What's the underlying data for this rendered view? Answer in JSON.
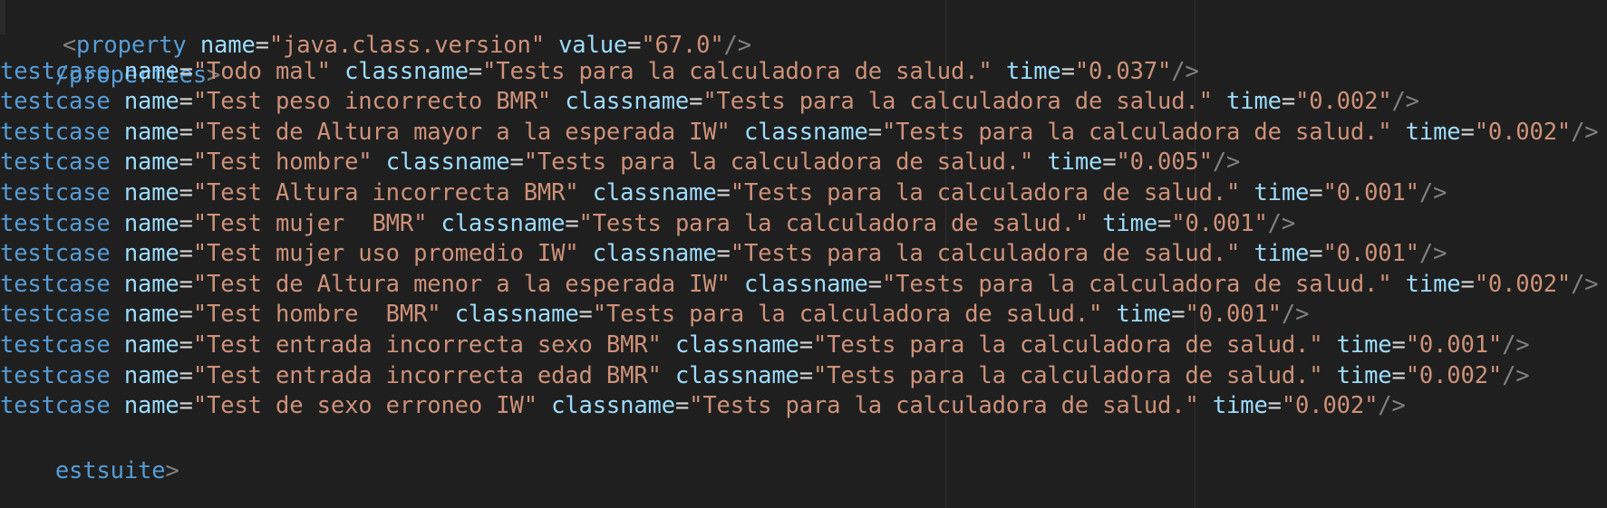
{
  "editor": {
    "property_line": {
      "tag": "property",
      "attrs": [
        {
          "name": "name",
          "value": "\"java.class.version\""
        },
        {
          "name": "value",
          "value": "\"67.0\""
        }
      ],
      "close": "/>"
    },
    "properties_close": {
      "tag": "/properties"
    },
    "testcases": [
      {
        "name": "\"Todo mal\"",
        "classname": "\"Tests para la calculadora de salud.\"",
        "time": "\"0.037\""
      },
      {
        "name": "\"Test peso incorrecto BMR\"",
        "classname": "\"Tests para la calculadora de salud.\"",
        "time": "\"0.002\""
      },
      {
        "name": "\"Test de Altura mayor a la esperada IW\"",
        "classname": "\"Tests para la calculadora de salud.\"",
        "time": "\"0.002\""
      },
      {
        "name": "\"Test hombre\"",
        "classname": "\"Tests para la calculadora de salud.\"",
        "time": "\"0.005\""
      },
      {
        "name": "\"Test Altura incorrecta BMR\"",
        "classname": "\"Tests para la calculadora de salud.\"",
        "time": "\"0.001\""
      },
      {
        "name": "\"Test mujer  BMR\"",
        "classname": "\"Tests para la calculadora de salud.\"",
        "time": "\"0.001\""
      },
      {
        "name": "\"Test mujer uso promedio IW\"",
        "classname": "\"Tests para la calculadora de salud.\"",
        "time": "\"0.001\""
      },
      {
        "name": "\"Test de Altura menor a la esperada IW\"",
        "classname": "\"Tests para la calculadora de salud.\"",
        "time": "\"0.002\""
      },
      {
        "name": "\"Test hombre  BMR\"",
        "classname": "\"Tests para la calculadora de salud.\"",
        "time": "\"0.001\""
      },
      {
        "name": "\"Test entrada incorrecta sexo BMR\"",
        "classname": "\"Tests para la calculadora de salud.\"",
        "time": "\"0.001\""
      },
      {
        "name": "\"Test entrada incorrecta edad BMR\"",
        "classname": "\"Tests para la calculadora de salud.\"",
        "time": "\"0.002\""
      },
      {
        "name": "\"Test de sexo erroneo IW\"",
        "classname": "\"Tests para la calculadora de salud.\"",
        "time": "\"0.002\""
      }
    ],
    "testcase_tag": "testcase",
    "attr_name": "name",
    "attr_classname": "classname",
    "attr_time": "time",
    "self_close": "/>",
    "testsuite_close": "estsuite"
  },
  "colors": {
    "background": "#1f1f1f",
    "tag": "#569cd6",
    "attribute": "#9cdcfe",
    "string": "#ce9178",
    "punctuation": "#808080"
  }
}
